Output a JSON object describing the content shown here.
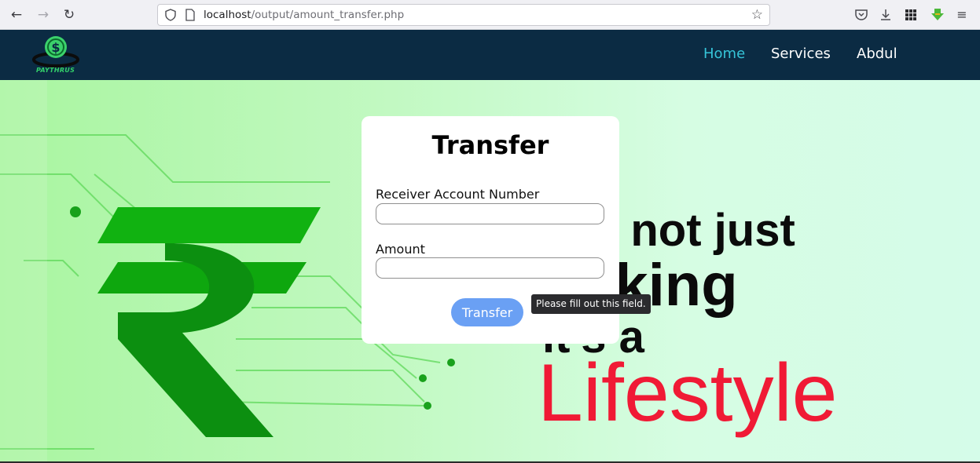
{
  "browser": {
    "url_host": "localhost",
    "url_path": "/output/amount_transfer.php"
  },
  "site": {
    "logo_text": "PAYTHRUS",
    "nav": [
      "Home",
      "Services",
      "Abdul"
    ]
  },
  "hero": {
    "line1": "s not just",
    "line2": "nking",
    "line3": "it's a",
    "line4": "Lifestyle"
  },
  "form": {
    "title": "Transfer",
    "receiver_label": "Receiver Account Number",
    "receiver_value": "",
    "amount_label": "Amount",
    "amount_value": "",
    "submit_label": "Transfer",
    "validation_message": "Please fill out this field."
  },
  "colors": {
    "navbar": "#0b2b43",
    "nav_active": "#36c4d8",
    "button": "#6aa0f4",
    "lifestyle": "#f01a35"
  }
}
